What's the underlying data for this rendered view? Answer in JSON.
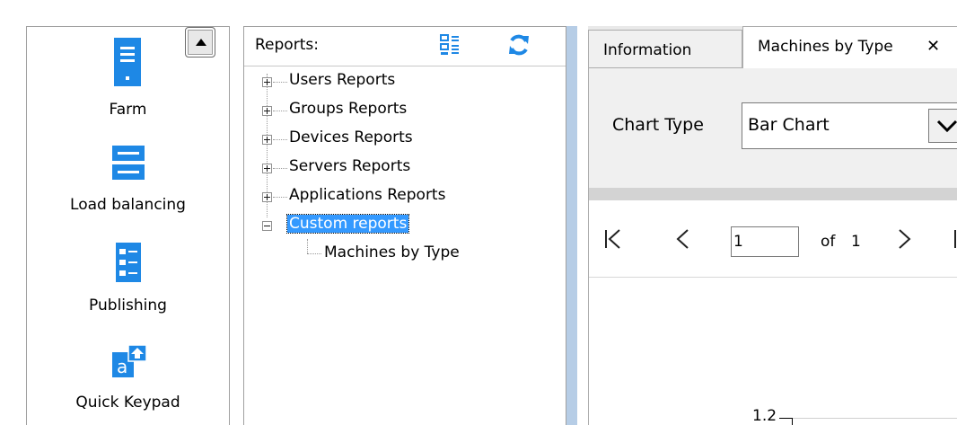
{
  "nav": {
    "items": [
      {
        "label": "Farm",
        "icon": "server-icon"
      },
      {
        "label": "Load balancing",
        "icon": "load-balancing-icon"
      },
      {
        "label": "Publishing",
        "icon": "publishing-icon"
      },
      {
        "label": "Quick Keypad",
        "icon": "quick-keypad-icon"
      }
    ],
    "scroll_up_icon": "triangle-up-icon"
  },
  "reports": {
    "title": "Reports:",
    "tree": [
      {
        "label": "Users Reports",
        "state": "collapsed"
      },
      {
        "label": "Groups Reports",
        "state": "collapsed"
      },
      {
        "label": "Devices Reports",
        "state": "collapsed"
      },
      {
        "label": "Servers Reports",
        "state": "collapsed"
      },
      {
        "label": "Applications Reports",
        "state": "collapsed"
      },
      {
        "label": "Custom reports",
        "state": "expanded",
        "selected": true,
        "children": [
          {
            "label": "Machines by Type"
          }
        ]
      }
    ],
    "icons": {
      "view": "tile-view-icon",
      "refresh": "refresh-icon"
    }
  },
  "tabs": [
    {
      "label": "Information",
      "active": false
    },
    {
      "label": "Machines by Type",
      "active": true,
      "closable": true
    }
  ],
  "chart_type": {
    "label": "Chart Type",
    "selected": "Bar Chart"
  },
  "pager": {
    "current": "1",
    "of_label": "of",
    "total": "1"
  },
  "chart_preview": {
    "first_tick": "1.2"
  },
  "colors": {
    "accent_blue": "#1e88e5",
    "selection": "#3399ff",
    "splitter": "#b6cde6"
  }
}
